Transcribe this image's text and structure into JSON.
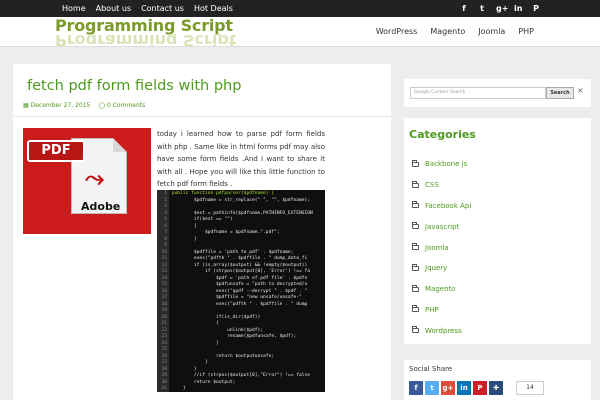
{
  "topnav": {
    "items": [
      "Home",
      "About us",
      "Contact us",
      "Hot Deals"
    ],
    "social_icons": [
      "facebook-icon",
      "twitter-icon",
      "google-plus-icon",
      "linkedin-icon",
      "pinterest-icon"
    ]
  },
  "header": {
    "logo_text": "Programming Script",
    "nav": [
      "WordPress",
      "Magento",
      "Joomla",
      "PHP"
    ]
  },
  "post": {
    "title": "fetch pdf form fields with php",
    "date": "December 27, 2015",
    "comments": "0 Comments",
    "image": {
      "banner": "PDF",
      "brand": "Adobe"
    },
    "body": "today i learned how to parse pdf form fields with php . Same like in html forms pdf may also have some form fields .And i want to share it with all . Hope you will like this little function to fetch pdf form fields .",
    "code_lines": [
      {
        "n": "1",
        "t": "public function pdfparser($pdfname) {"
      },
      {
        "n": "2",
        "t": "        $pdfname = str_replace(\" \", \"\", $pdfname);"
      },
      {
        "n": "3",
        "t": ""
      },
      {
        "n": "4",
        "t": "        $ext = pathinfo($pdfname,PATHINFO_EXTENSION"
      },
      {
        "n": "5",
        "t": "        if($ext == \"\")"
      },
      {
        "n": "6",
        "t": "        {"
      },
      {
        "n": "7",
        "t": "            $pdfname = $pdfname.\".pdf\";"
      },
      {
        "n": "8",
        "t": "        }"
      },
      {
        "n": "9",
        "t": ""
      },
      {
        "n": "10",
        "t": "        $pdffile = 'path to pdf' . $pdfname;"
      },
      {
        "n": "11",
        "t": "        exec(\"pdftk \" . $pdffile . \" dump_data_fi"
      },
      {
        "n": "12",
        "t": "        if (is_array($output) && !empty($output))"
      },
      {
        "n": "13",
        "t": "            if (strpos($output[0], 'Error') !== fa"
      },
      {
        "n": "14",
        "t": "                $pdf = 'path of pdf file' . $pdfn"
      },
      {
        "n": "15",
        "t": "                $pdfunsafe = \"path to decrypted/u"
      },
      {
        "n": "16",
        "t": "                exec(\"qpdf --decrypt \" . $pdf . \""
      },
      {
        "n": "17",
        "t": "                $pdffile = \"new unsafe/unsafe-\""
      },
      {
        "n": "18",
        "t": "                exec(\"pdftk \" . $pdffile . \" dump"
      },
      {
        "n": "19",
        "t": ""
      },
      {
        "n": "20",
        "t": "                if(is_dir($pdf))"
      },
      {
        "n": "21",
        "t": "                {"
      },
      {
        "n": "22",
        "t": "                    unlink($pdf);"
      },
      {
        "n": "23",
        "t": "                    rename($pdfunsafe, $pdf);"
      },
      {
        "n": "24",
        "t": "                }"
      },
      {
        "n": "25",
        "t": ""
      },
      {
        "n": "26",
        "t": "                return $outputunsafe;"
      },
      {
        "n": "27",
        "t": "            }"
      },
      {
        "n": "28",
        "t": "        }"
      },
      {
        "n": "29",
        "t": "        //if (strpos($output[0],\"Error\") !== false"
      },
      {
        "n": "30",
        "t": "        return $output;"
      },
      {
        "n": "31",
        "t": "    }"
      }
    ]
  },
  "sidebar": {
    "search": {
      "placeholder": "Google Custom Search",
      "button": "Search",
      "clear": "×"
    },
    "categories_title": "Categories",
    "categories": [
      "Backbone js",
      "CSS",
      "Facebook Api",
      "Javascript",
      "Joomla",
      "Jquery",
      "Magento",
      "PHP",
      "Wordpress"
    ],
    "social_share_title": "Social Share",
    "share_buttons": [
      {
        "glyph": "f",
        "color": "#3b5998",
        "icon": "facebook-icon"
      },
      {
        "glyph": "t",
        "color": "#55acee",
        "icon": "twitter-icon"
      },
      {
        "glyph": "g+",
        "color": "#dd4b39",
        "icon": "google-plus-icon"
      },
      {
        "glyph": "in",
        "color": "#0077b5",
        "icon": "linkedin-icon"
      },
      {
        "glyph": "P",
        "color": "#cb2027",
        "icon": "pinterest-icon"
      },
      {
        "glyph": "✚",
        "color": "#2a4d7a",
        "icon": "share-icon"
      }
    ],
    "share_count": "14"
  },
  "colors": {
    "accent": "#4d9b1c",
    "topbar": "#222222"
  }
}
